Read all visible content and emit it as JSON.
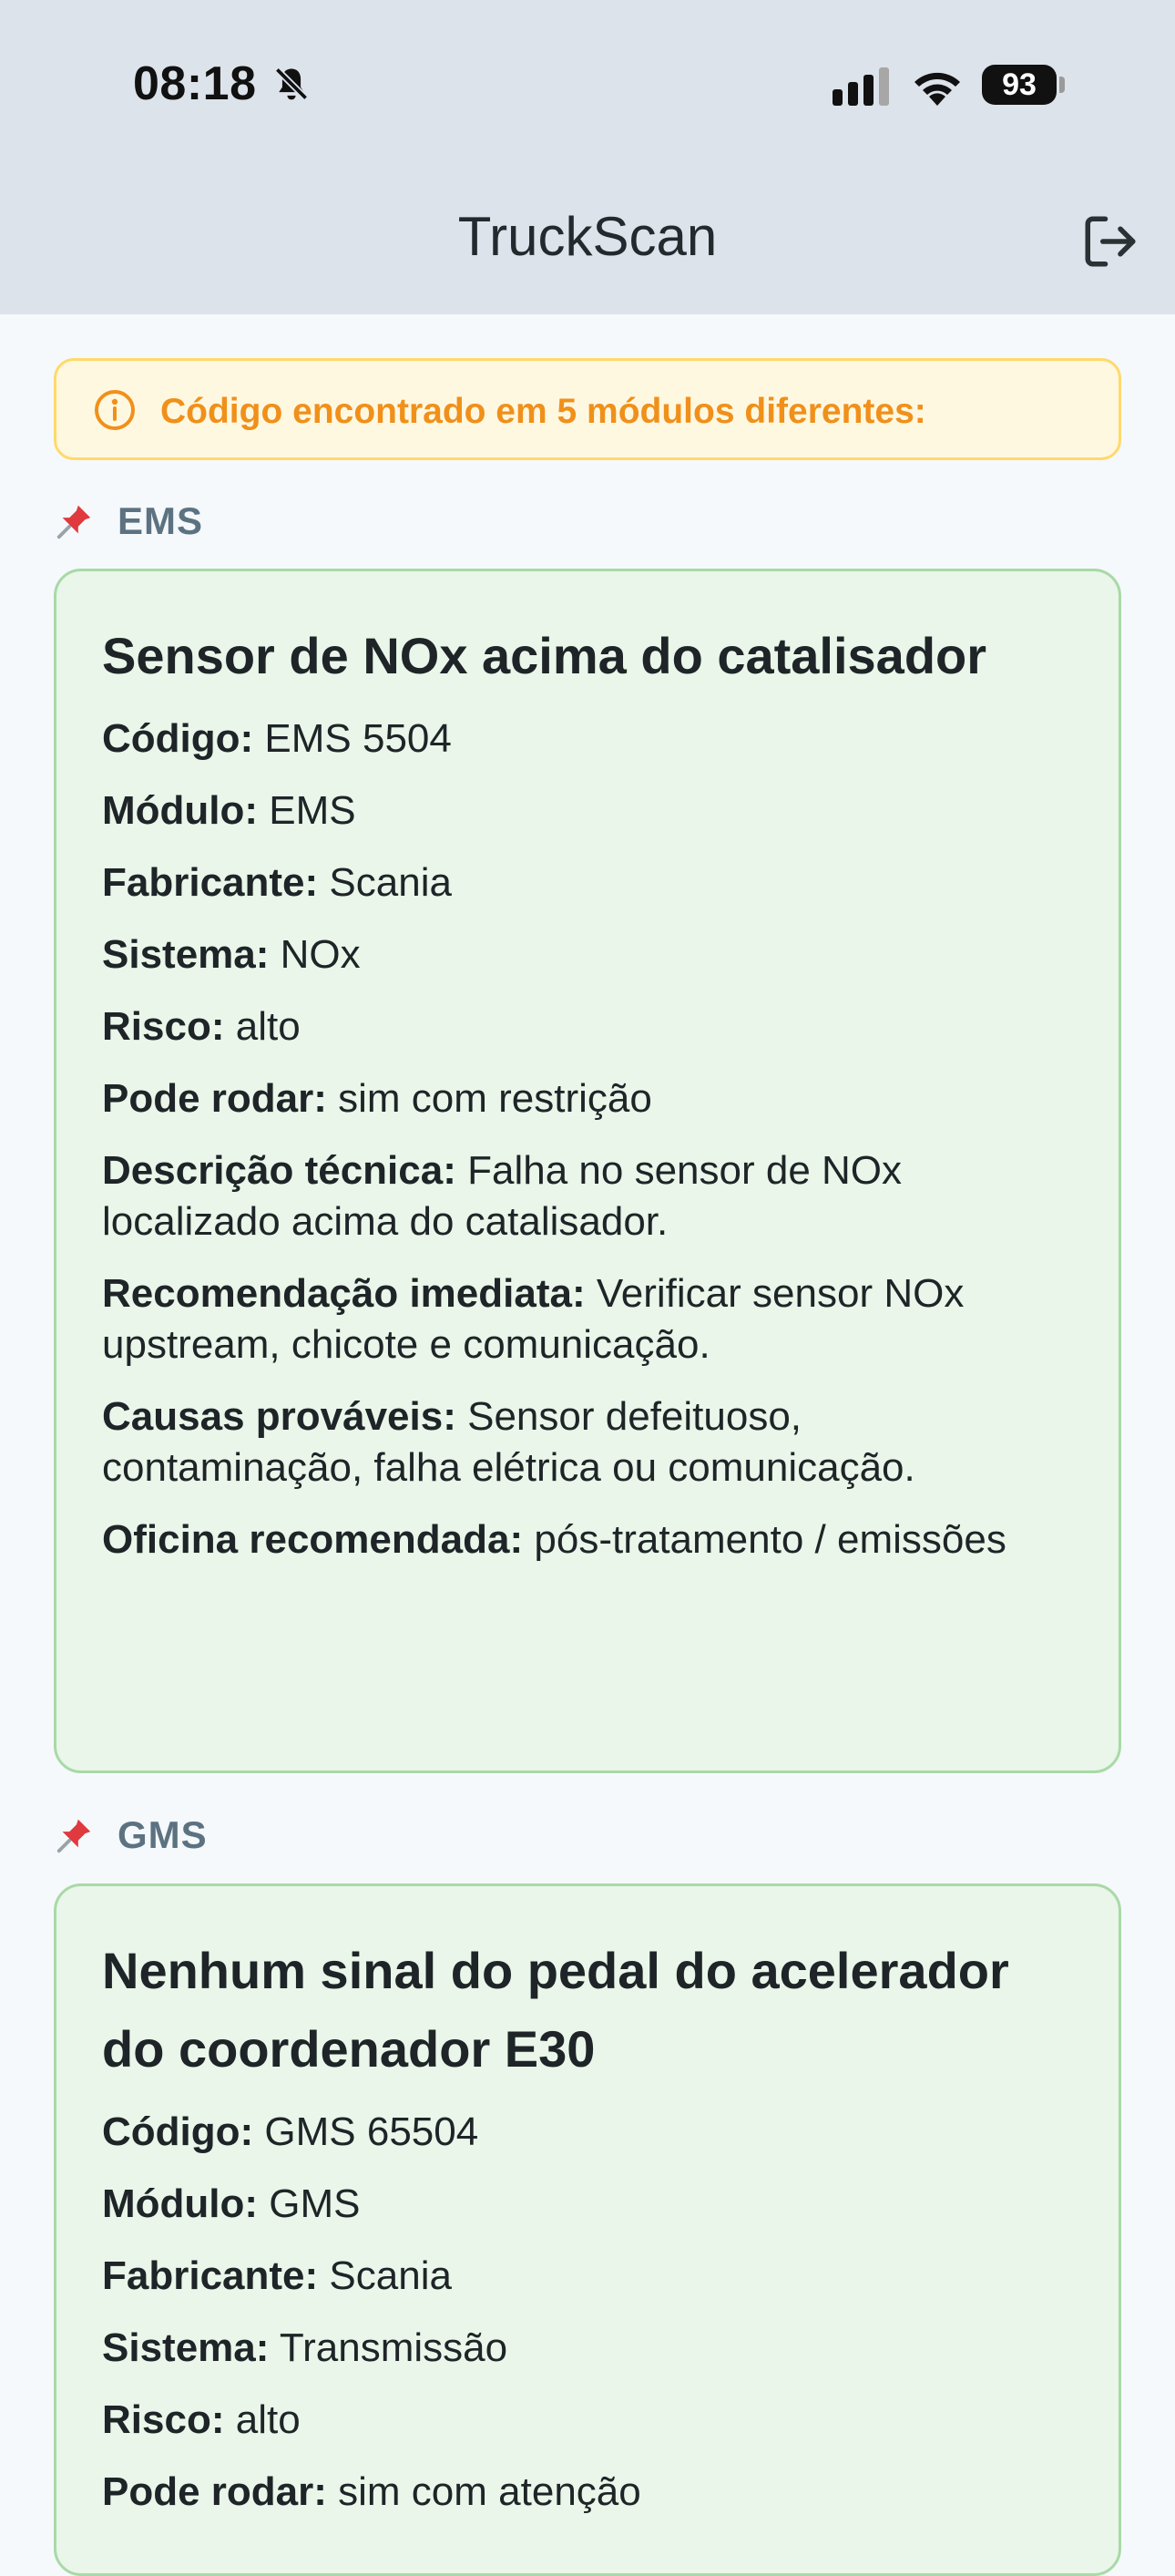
{
  "status_bar": {
    "time": "08:18",
    "battery": "93"
  },
  "header": {
    "title": "TruckScan"
  },
  "alert": {
    "text": "Código encontrado em 5 módulos diferentes:"
  },
  "modules": [
    {
      "label": "EMS",
      "title": "Sensor de NOx acima do catalisador",
      "fields": [
        {
          "label": "Código:",
          "value": "EMS 5504"
        },
        {
          "label": "Módulo:",
          "value": "EMS"
        },
        {
          "label": "Fabricante:",
          "value": "Scania"
        },
        {
          "label": "Sistema:",
          "value": "NOx"
        },
        {
          "label": "Risco:",
          "value": "alto"
        },
        {
          "label": "Pode rodar:",
          "value": "sim com restrição"
        },
        {
          "label": "Descrição técnica:",
          "value": "Falha no sensor de NOx localizado acima do catalisador."
        },
        {
          "label": "Recomendação imediata:",
          "value": "Verificar sensor NOx upstream, chicote e comunicação."
        },
        {
          "label": "Causas prováveis:",
          "value": "Sensor defeituoso, contaminação, falha elétrica ou comunicação."
        },
        {
          "label": "Oficina recomendada:",
          "value": "pós-tratamento / emissões"
        }
      ]
    },
    {
      "label": "GMS",
      "title": "Nenhum sinal do pedal do acelerador do coordenador E30",
      "fields": [
        {
          "label": "Código:",
          "value": "GMS 65504"
        },
        {
          "label": "Módulo:",
          "value": "GMS"
        },
        {
          "label": "Fabricante:",
          "value": "Scania"
        },
        {
          "label": "Sistema:",
          "value": "Transmissão"
        },
        {
          "label": "Risco:",
          "value": "alto"
        },
        {
          "label": "Pode rodar:",
          "value": "sim com atenção"
        }
      ]
    }
  ],
  "colors": {
    "header_bg": "#dde3ea",
    "page_bg": "#f5f9fc",
    "alert_bg": "#fff8e1",
    "alert_text": "#f0901a",
    "card_bg": "#e9f6e9",
    "card_border": "#a9d9a7",
    "module_label": "#5d7281"
  },
  "icons": {
    "status": [
      "bell-off-icon",
      "cellular-signal-icon",
      "wifi-icon",
      "battery-icon"
    ],
    "header": "logout-icon",
    "alert": "info-circle-icon",
    "module": "pushpin-icon"
  }
}
